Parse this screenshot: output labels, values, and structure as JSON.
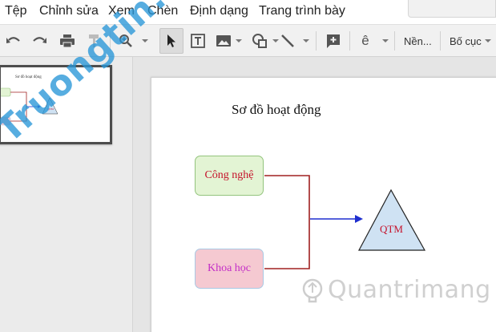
{
  "menu": {
    "items": [
      "Tệp",
      "Chỉnh sửa",
      "Xem",
      "Chèn",
      "Định dạng",
      "Trang trình bày"
    ]
  },
  "toolbar": {
    "buttons": [
      {
        "icon": "undo-icon"
      },
      {
        "icon": "redo-icon"
      },
      {
        "icon": "print-icon"
      },
      {
        "icon": "paint-format-icon"
      },
      {
        "icon": "zoom-icon"
      },
      {
        "icon": "select-cursor-icon"
      },
      {
        "icon": "text-box-icon"
      },
      {
        "icon": "image-icon"
      },
      {
        "icon": "shape-icon"
      },
      {
        "icon": "line-icon"
      },
      {
        "icon": "add-comment-icon"
      },
      {
        "icon": "input-tools-icon"
      }
    ],
    "input_tool_glyph": "ê",
    "background_label": "Nền...",
    "layout_label": "Bố cục"
  },
  "filmstrip": {
    "thumbnail_title": "Sơ đồ hoạt động"
  },
  "slide": {
    "title": "Sơ đồ hoạt động",
    "box_top": "Công nghệ",
    "box_bottom": "Khoa học",
    "triangle_label": "QTM",
    "colors": {
      "box_top_fill": "#e3f4d4",
      "box_top_border": "#93c47d",
      "box_bottom_fill": "#f5c9d1",
      "box_bottom_border": "#a9c9e4",
      "connector": "#a02020",
      "arrow": "#1f2fcf",
      "triangle_fill": "#cfe2f3",
      "label_red": "#c5112a",
      "label_magenta": "#c32ec7"
    }
  },
  "watermarks": {
    "left": "Truongtin.top",
    "right": "Quantrimang"
  }
}
